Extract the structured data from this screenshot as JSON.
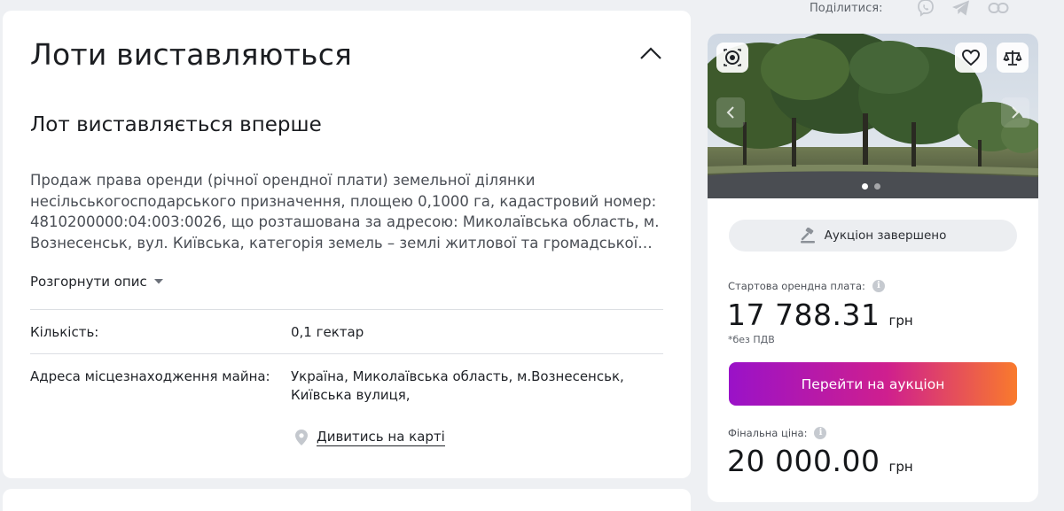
{
  "share": {
    "label": "Поділитися:",
    "icons": [
      "viber-icon",
      "telegram-icon",
      "link-icon"
    ]
  },
  "lot": {
    "section_title": "Лоти виставляються",
    "subtitle": "Лот виставляється вперше",
    "description": "Продаж права оренди (річної орендної плати) земельної ділянки несільськогосподарського призначення, площею 0,1000 га, кадастровий номер: 4810200000:04:003:0026, що розташована за адресою: Миколаївська область, м. Вознесенськ, вул. Київська, категорія земель – землі житлової та громадської забудови",
    "expand_label": "Розгорнути опис",
    "quantity": {
      "label": "Кількість:",
      "value": "0,1 гектар"
    },
    "address": {
      "label": "Адреса місцезнаходження майна:",
      "value": "Україна, Миколаївська область, м.Вознесенськ, Київська вулиця,",
      "map_link": "Дивитись на карті"
    }
  },
  "auction_card": {
    "gallery": {
      "slides": 2,
      "active_slide": 1
    },
    "status": "Аукціон завершено",
    "start_price": {
      "label": "Стартова орендна плата:",
      "value": "17 788.31",
      "currency": "грн",
      "note": "*без ПДВ"
    },
    "cta": "Перейти на аукціон",
    "final_price": {
      "label": "Фінальна ціна:",
      "value": "20 000.00",
      "currency": "грн"
    }
  },
  "colors": {
    "accent_gradient": [
      "#9a12c8",
      "#cf1f8e",
      "#f97a2c"
    ],
    "background": "#eef0f3",
    "card": "#ffffff"
  }
}
